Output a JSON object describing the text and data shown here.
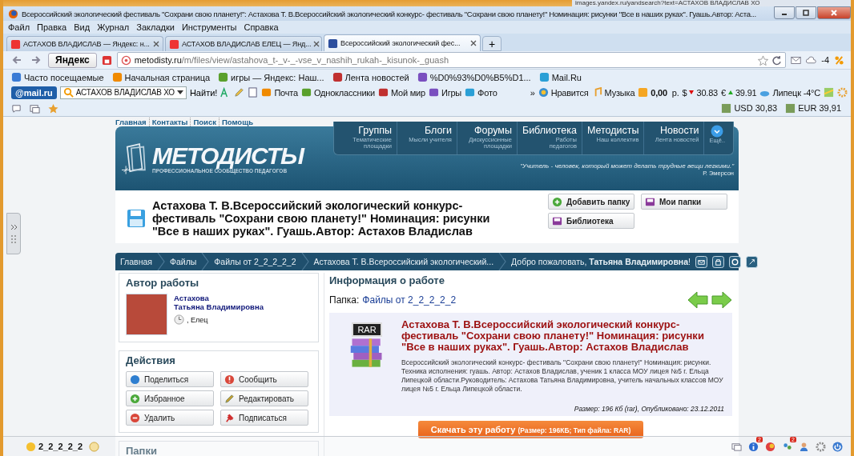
{
  "background_window": {
    "address": "images.yandex.ru/yandsearch?text=АСТАХОВ ВЛАДИСЛАВ ХО"
  },
  "window": {
    "title": "Всероссийский экологический фестиваль \"Сохрани свою планету!\": Астахова Т. В.Всероссийский экологический конкурс- фестиваль \"Сохрани свою планету!\" Номинация: рисунки \"Все в наших руках\". Гуашь.Автор: Аста..."
  },
  "menu": [
    "Файл",
    "Правка",
    "Вид",
    "Журнал",
    "Закладки",
    "Инструменты",
    "Справка"
  ],
  "tabs": [
    {
      "label": "АСТАХОВ ВЛАДИСЛАВ — Яндекс: н...",
      "selected": false
    },
    {
      "label": "АСТАХОВ ВЛАДИСЛАВ ЕЛЕЦ — Янд...",
      "selected": false
    },
    {
      "label": "Всероссийский экологический фес...",
      "selected": true
    }
  ],
  "new_tab": "+",
  "address_bar": {
    "search_logo": "Яндекс",
    "url_host": "metodisty.ru",
    "url_path": "/m/files/view/astahova_t-_v-_-vse_v_nashih_rukah-_kisunok-_guash",
    "weather": "-4"
  },
  "bookmarks": [
    "Часто посещаемые",
    "Начальная страница",
    "игры — Яндекс: Наш...",
    "Лента новостей",
    "%D0%93%D0%B5%D1...",
    "Mail.Ru"
  ],
  "mail_toolbar": {
    "logo": "@mail.ru",
    "search_value": "АСТАХОВ ВЛАДИСЛАВ ХО",
    "find": "Найти!",
    "items": [
      "Почта",
      "Одноклассники",
      "Мой мир",
      "Игры",
      "Фото"
    ],
    "more": "»",
    "likes": "Нравится",
    "music": "Музыка",
    "balance": "0,00",
    "balance_unit": "р.",
    "usd_symbol": "$",
    "usd": "30.83",
    "eur_symbol": "€",
    "eur": "39.91",
    "weather": "Липецк -4°C"
  },
  "currency_bar": {
    "usd": "USD 30,83",
    "eur": "EUR 39,91"
  },
  "site": {
    "top_links": [
      "Главная",
      "Контакты",
      "Поиск",
      "Помощь"
    ],
    "logo": {
      "name": "МЕТОДИСТЫ",
      "tagline": "ПРОФЕССИОНАЛЬНОЕ СООБЩЕСТВО ПЕДАГОГОВ"
    },
    "nav": [
      {
        "label": "Группы",
        "sub": "Тематические площадки"
      },
      {
        "label": "Блоги",
        "sub": "Мысли учителя"
      },
      {
        "label": "Форумы",
        "sub": "Дискуссионные площадки"
      },
      {
        "label": "Библиотека",
        "sub": "Работы педагогов"
      },
      {
        "label": "Методисты",
        "sub": "Наш коллектив"
      },
      {
        "label": "Новости",
        "sub": "Лента новостей"
      }
    ],
    "nav_more": "Ещё..",
    "quote": {
      "text": "\"Учитель - человек, который может делать трудные вещи легкими.\"",
      "author": "Р. Эмерсон"
    },
    "page_title": "Астахова Т. В.Всероссийский экологический конкурс- фестиваль \"Сохрани свою планету!\" Номинация: рисунки \"Все в наших руках\". Гуашь.Автор: Астахов Владислав",
    "title_buttons": [
      {
        "label": "Добавить папку",
        "kind": "add"
      },
      {
        "label": "Мои папки",
        "kind": "folder"
      },
      {
        "label": "Библиотека",
        "kind": "folder"
      }
    ],
    "breadcrumbs": [
      "Главная",
      "Файлы",
      "Файлы от 2_2_2_2_2",
      "Астахова Т. В.Всероссийский экологический..."
    ],
    "welcome": "Добро пожаловать, **Татьяна Владимировна**!",
    "author_card": {
      "heading": "Автор работы",
      "name_lines": [
        "Астахова",
        "Татьяна Владимировна"
      ],
      "city": ", Елец"
    },
    "actions": {
      "heading": "Действия",
      "buttons": [
        {
          "label": "Поделиться",
          "kind": "share"
        },
        {
          "label": "Сообщить",
          "kind": "report"
        },
        {
          "label": "Избранное",
          "kind": "add"
        },
        {
          "label": "Редактировать",
          "kind": "edit"
        },
        {
          "label": "Удалить",
          "kind": "delete"
        },
        {
          "label": "Подписаться",
          "kind": "pin"
        }
      ]
    },
    "folders_heading": "Папки",
    "info": {
      "heading": "Информация о работе",
      "folder_label": "Папка:",
      "folder_link": "Файлы от 2_2_2_2_2",
      "file": {
        "badge": "RAR",
        "title": "Астахова Т. В.Всероссийский экологический конкурс- фестиваль \"Сохрани свою планету!\" Номинация: рисунки \"Все в наших руках\". Гуашь.Автор: Астахов Владислав",
        "description": "Всероссийский экологический конкурс- фестиваль \"Сохрани свою планету!\" Номинация: рисунки. Техника исполнения: гуашь. Автор: Астахов Владислав, ученик 1 класса МОУ лицея №5 г. Ельца Липецкой области.Руководитель: Астахова Татьяна Владимировна, учитель начальных классов МОУ лицея №5 г. Ельца Липецкой области.",
        "meta": "Размер: 196 Кб (rar), Опубликовано: 23.12.2011"
      },
      "download": {
        "label": "Скачать эту работу",
        "details": "(Размер: 196КБ; Тип файла: RAR)"
      }
    }
  },
  "bottom_bar": {
    "user": "2_2_2_2_2",
    "badges": [
      "2",
      "2"
    ]
  }
}
